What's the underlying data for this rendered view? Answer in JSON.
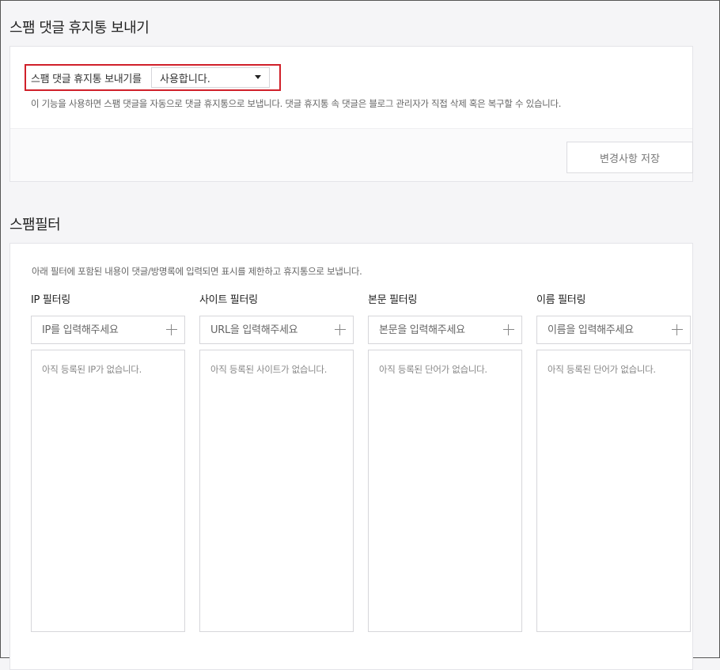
{
  "spam_trash": {
    "title": "스팸 댓글 휴지통 보내기",
    "label": "스팸 댓글 휴지통 보내기를",
    "selected": "사용합니다.",
    "help": "이 기능을 사용하면 스팸 댓글을 자동으로 댓글 휴지통으로 보냅니다. 댓글 휴지통 속 댓글은 블로그 관리자가 직접 삭제 혹은 복구할 수 있습니다.",
    "save_label": "변경사항 저장"
  },
  "spam_filter": {
    "title": "스팸필터",
    "description": "아래 필터에 포함된 내용이 댓글/방명록에 입력되면 표시를 제한하고 휴지통으로 보냅니다.",
    "filters": [
      {
        "title": "IP 필터링",
        "placeholder": "IP를 입력해주세요",
        "empty": "아직 등록된 IP가 없습니다."
      },
      {
        "title": "사이트 필터링",
        "placeholder": "URL을 입력해주세요",
        "empty": "아직 등록된 사이트가 없습니다."
      },
      {
        "title": "본문 필터링",
        "placeholder": "본문을 입력해주세요",
        "empty": "아직 등록된 단어가 없습니다."
      },
      {
        "title": "이름 필터링",
        "placeholder": "이름을 입력해주세요",
        "empty": "아직 등록된 단어가 없습니다."
      }
    ]
  },
  "colors": {
    "highlight_border": "#d0202a",
    "background": "#f5f5f7"
  }
}
